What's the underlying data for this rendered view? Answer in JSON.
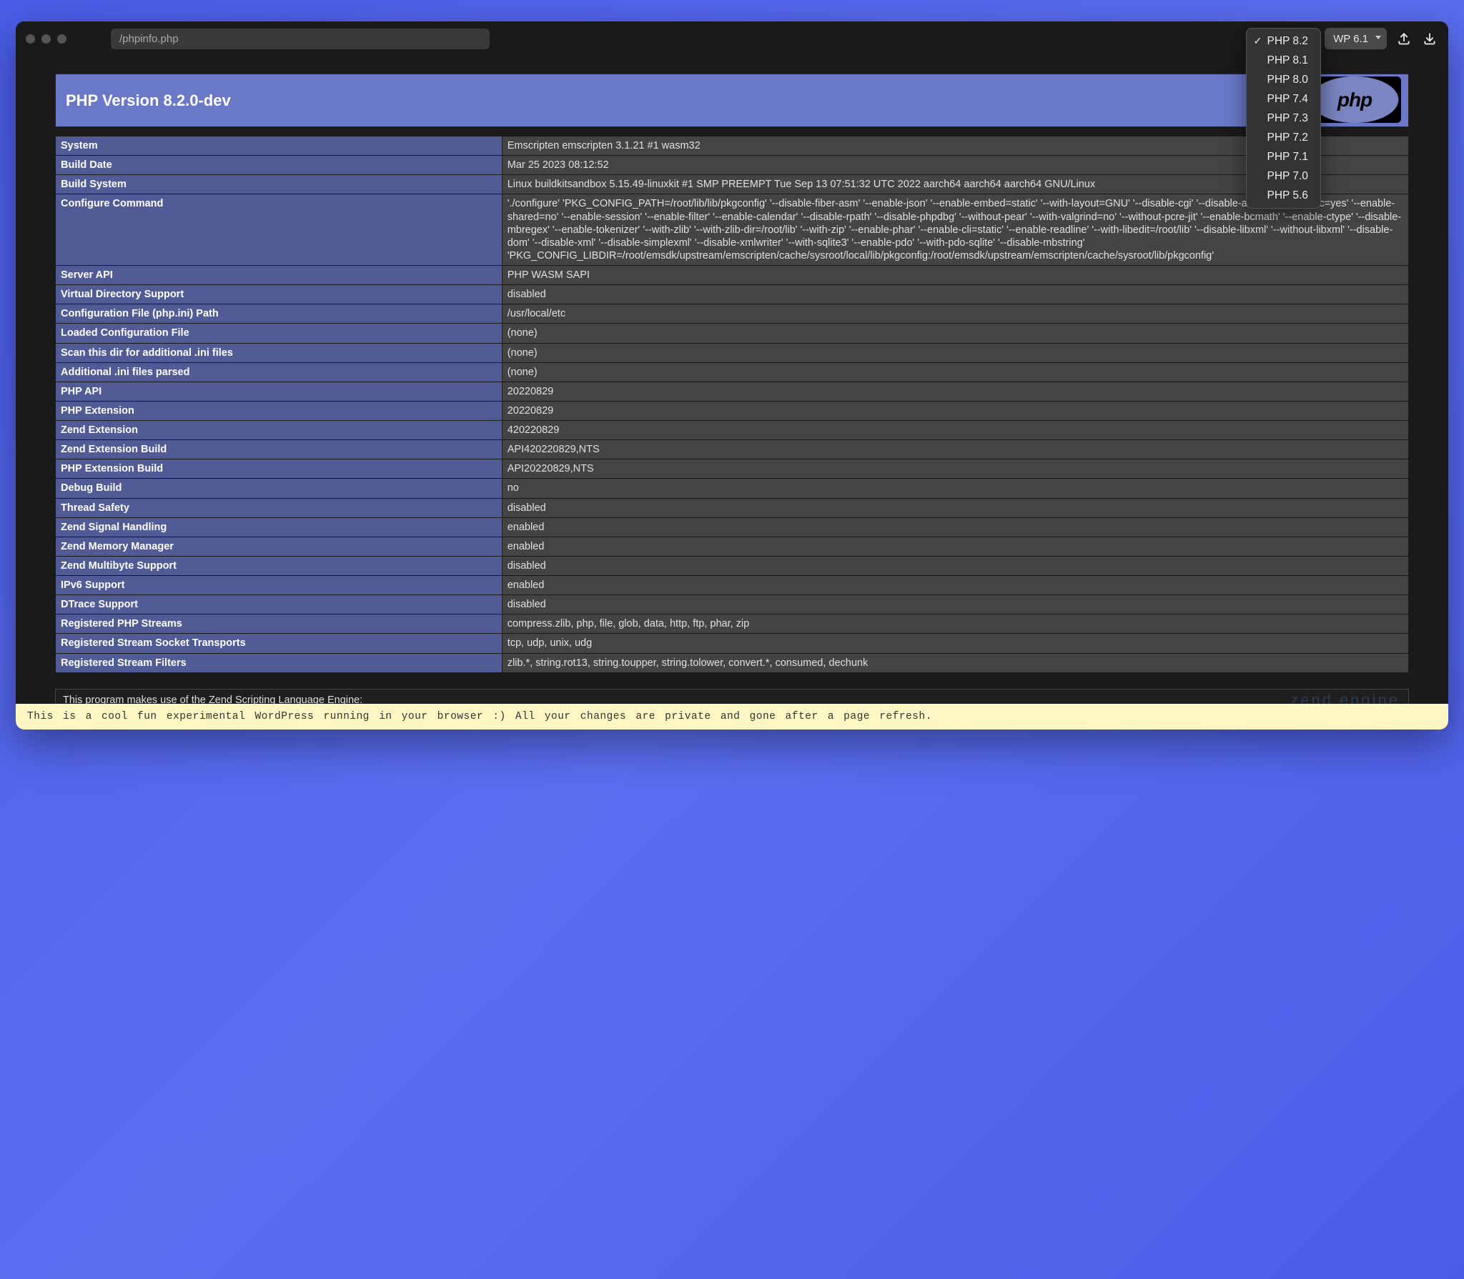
{
  "toolbar": {
    "address": "/phpinfo.php",
    "php_selector_label": "PHP 8.2",
    "wp_selector_label": "WP 6.1",
    "php_options": [
      "PHP 8.2",
      "PHP 8.1",
      "PHP 8.0",
      "PHP 7.4",
      "PHP 7.3",
      "PHP 7.2",
      "PHP 7.1",
      "PHP 7.0",
      "PHP 5.6"
    ],
    "php_selected_index": 0
  },
  "header": {
    "title": "PHP Version 8.2.0-dev",
    "logo_text": "php"
  },
  "rows": [
    {
      "k": "System",
      "v": "Emscripten emscripten 3.1.21 #1 wasm32"
    },
    {
      "k": "Build Date",
      "v": "Mar 25 2023 08:12:52"
    },
    {
      "k": "Build System",
      "v": "Linux buildkitsandbox 5.15.49-linuxkit #1 SMP PREEMPT Tue Sep 13 07:51:32 UTC 2022 aarch64 aarch64 aarch64 GNU/Linux"
    },
    {
      "k": "Configure Command",
      "v": "'./configure' 'PKG_CONFIG_PATH=/root/lib/lib/pkgconfig' '--disable-fiber-asm' '--enable-json' '--enable-embed=static' '--with-layout=GNU' '--disable-cgi' '--disable-all' '--enable-static=yes' '--enable-shared=no' '--enable-session' '--enable-filter' '--enable-calendar' '--disable-rpath' '--disable-phpdbg' '--without-pear' '--with-valgrind=no' '--without-pcre-jit' '--enable-bcmath' '--enable-ctype' '--disable-mbregex' '--enable-tokenizer' '--with-zlib' '--with-zlib-dir=/root/lib' '--with-zip' '--enable-phar' '--enable-cli=static' '--enable-readline' '--with-libedit=/root/lib' '--disable-libxml' '--without-libxml' '--disable-dom' '--disable-xml' '--disable-simplexml' '--disable-xmlwriter' '--with-sqlite3' '--enable-pdo' '--with-pdo-sqlite' '--disable-mbstring' 'PKG_CONFIG_LIBDIR=/root/emsdk/upstream/emscripten/cache/sysroot/local/lib/pkgconfig:/root/emsdk/upstream/emscripten/cache/sysroot/lib/pkgconfig'"
    },
    {
      "k": "Server API",
      "v": "PHP WASM SAPI"
    },
    {
      "k": "Virtual Directory Support",
      "v": "disabled"
    },
    {
      "k": "Configuration File (php.ini) Path",
      "v": "/usr/local/etc"
    },
    {
      "k": "Loaded Configuration File",
      "v": "(none)"
    },
    {
      "k": "Scan this dir for additional .ini files",
      "v": "(none)"
    },
    {
      "k": "Additional .ini files parsed",
      "v": "(none)"
    },
    {
      "k": "PHP API",
      "v": "20220829"
    },
    {
      "k": "PHP Extension",
      "v": "20220829"
    },
    {
      "k": "Zend Extension",
      "v": "420220829"
    },
    {
      "k": "Zend Extension Build",
      "v": "API420220829,NTS"
    },
    {
      "k": "PHP Extension Build",
      "v": "API20220829,NTS"
    },
    {
      "k": "Debug Build",
      "v": "no"
    },
    {
      "k": "Thread Safety",
      "v": "disabled"
    },
    {
      "k": "Zend Signal Handling",
      "v": "enabled"
    },
    {
      "k": "Zend Memory Manager",
      "v": "enabled"
    },
    {
      "k": "Zend Multibyte Support",
      "v": "disabled"
    },
    {
      "k": "IPv6 Support",
      "v": "enabled"
    },
    {
      "k": "DTrace Support",
      "v": "disabled"
    },
    {
      "k": "Registered PHP Streams",
      "v": "compress.zlib, php, file, glob, data, http, ftp, phar, zip"
    },
    {
      "k": "Registered Stream Socket Transports",
      "v": "tcp, udp, unix, udg"
    },
    {
      "k": "Registered Stream Filters",
      "v": "zlib.*, string.rot13, string.toupper, string.tolower, convert.*, consumed, dechunk"
    }
  ],
  "zend": {
    "text": "This program makes use of the Zend Scripting Language Engine:",
    "logo": "zend engine"
  },
  "banner": "This is a cool fun experimental WordPress running in your browser :) All your changes are private and gone after a page refresh."
}
